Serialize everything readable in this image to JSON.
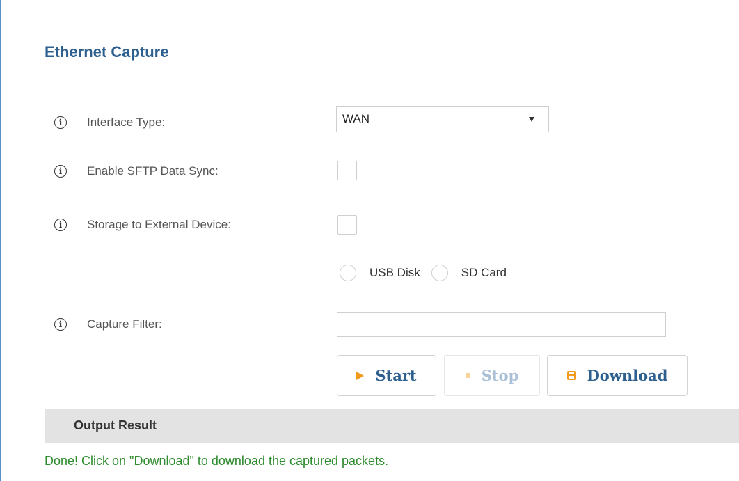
{
  "page": {
    "title": "Ethernet Capture"
  },
  "fields": {
    "interface_type": {
      "label": "Interface Type:",
      "value": "WAN"
    },
    "sftp_sync": {
      "label": "Enable SFTP Data Sync:",
      "checked": false
    },
    "external_storage": {
      "label": "Storage to External Device:",
      "checked": false
    },
    "storage_options": [
      "USB Disk",
      "SD Card"
    ],
    "capture_filter": {
      "label": "Capture Filter:",
      "value": ""
    }
  },
  "buttons": {
    "start": "Start",
    "stop": "Stop",
    "download": "Download"
  },
  "output": {
    "title": "Output Result",
    "message": "Done! Click on \"Download\" to download the captured packets."
  },
  "colors": {
    "title": "#2d5f8f",
    "accent": "#f29a1f",
    "success": "#2e8b2e",
    "output_bar": "#e3e3e3"
  }
}
